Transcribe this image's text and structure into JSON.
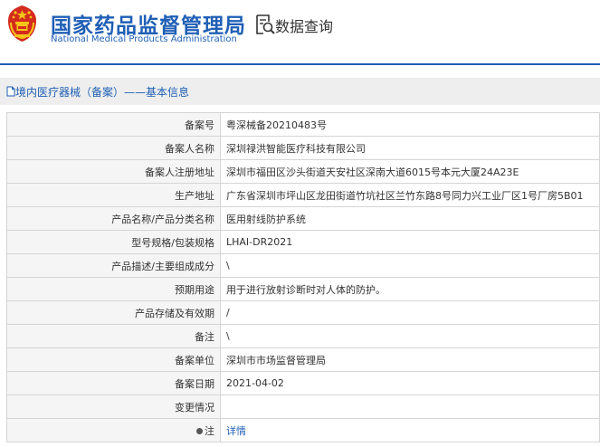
{
  "header": {
    "title_cn": "国家药品监督管理局",
    "title_en": "National Medical Products Administration",
    "search_label": "数据查询"
  },
  "breadcrumb": {
    "text": "境内医疗器械（备案）——基本信息"
  },
  "record": {
    "rows": [
      {
        "label": "备案号",
        "value": "粤深械备20210483号"
      },
      {
        "label": "备案人名称",
        "value": "深圳禄洪智能医疗科技有限公司"
      },
      {
        "label": "备案人注册地址",
        "value": "深圳市福田区沙头街道天安社区深南大道6015号本元大厦24A23E"
      },
      {
        "label": "生产地址",
        "value": "广东省深圳市坪山区龙田街道竹坑社区兰竹东路8号同力兴工业厂区1号厂房5B01"
      },
      {
        "label": "产品名称/产品分类名称",
        "value": "医用射线防护系统"
      },
      {
        "label": "型号规格/包装规格",
        "value": "LHAI-DR2021"
      },
      {
        "label": "产品描述/主要组成成分",
        "value": "\\"
      },
      {
        "label": "预期用途",
        "value": "用于进行放射诊断时对人体的防护。"
      },
      {
        "label": "产品存储及有效期",
        "value": "/"
      },
      {
        "label": "备注",
        "value": "\\"
      },
      {
        "label": "备案单位",
        "value": "深圳市市场监督管理局"
      },
      {
        "label": "备案日期",
        "value": "2021-04-02"
      },
      {
        "label": "变更情况",
        "value": ""
      },
      {
        "label": "注",
        "value": "详情"
      }
    ]
  },
  "colors": {
    "brand_blue": "#1f5fb5",
    "emblem_red": "#d32b1e",
    "emblem_gold": "#f5c518"
  }
}
